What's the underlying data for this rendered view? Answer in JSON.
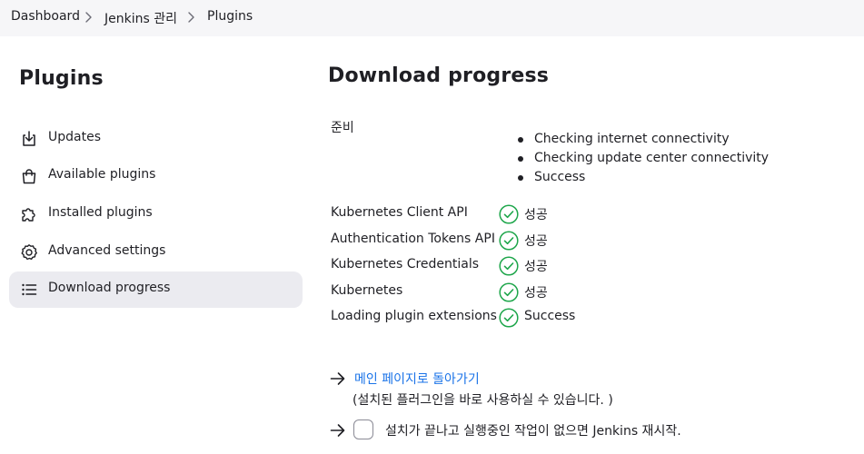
{
  "breadcrumb": {
    "items": [
      {
        "label": "Dashboard"
      },
      {
        "label": "Jenkins 관리"
      },
      {
        "label": "Plugins"
      }
    ]
  },
  "sidebar": {
    "title": "Plugins",
    "items": [
      {
        "label": "Updates",
        "icon": "download-icon"
      },
      {
        "label": "Available plugins",
        "icon": "shopping-bag-icon"
      },
      {
        "label": "Installed plugins",
        "icon": "puzzle-icon"
      },
      {
        "label": "Advanced settings",
        "icon": "gear-icon"
      },
      {
        "label": "Download progress",
        "icon": "list-icon",
        "active": true
      }
    ]
  },
  "main": {
    "title": "Download progress",
    "preparation": {
      "label": "준비",
      "steps": [
        "Checking internet connectivity",
        "Checking update center connectivity",
        "Success"
      ]
    },
    "plugins": [
      {
        "name": "Kubernetes Client API",
        "status": "성공"
      },
      {
        "name": "Authentication Tokens API",
        "status": "성공"
      },
      {
        "name": "Kubernetes Credentials",
        "status": "성공"
      },
      {
        "name": "Kubernetes",
        "status": "성공"
      },
      {
        "name": "Loading plugin extensions",
        "status": "Success"
      }
    ],
    "back_link": "메인 페이지로 돌아가기",
    "back_note": "(설치된 플러그인을 바로 사용하실 수 있습니다. )",
    "restart_label": "설치가 끝나고 실행중인 작업이 없으면 Jenkins 재시작.",
    "restart_checked": false
  },
  "colors": {
    "success": "#1ea64b",
    "link": "#1a73e8",
    "active_bg": "#ebebf0",
    "breadcrumb_bg": "#f6f6f8"
  }
}
